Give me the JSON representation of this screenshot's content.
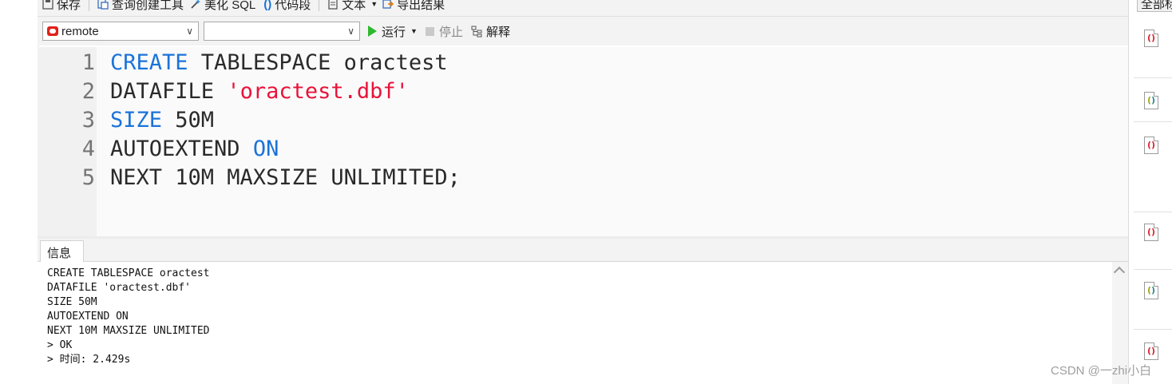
{
  "toolbar": {
    "save": "保存",
    "query_builder": "查询创建工具",
    "beautify_sql": "美化 SQL",
    "code_snippet": "代码段",
    "text": "文本",
    "export_results": "导出结果"
  },
  "run_bar": {
    "connection": "remote",
    "database": "",
    "run": "运行",
    "stop": "停止",
    "explain": "解释"
  },
  "editor": {
    "lines": [
      {
        "n": "1",
        "segments": [
          {
            "t": "CREATE",
            "c": "kw"
          },
          {
            "t": " TABLESPACE oractest",
            "c": "plain"
          }
        ]
      },
      {
        "n": "2",
        "segments": [
          {
            "t": "DATAFILE ",
            "c": "plain"
          },
          {
            "t": "'oractest.dbf'",
            "c": "str"
          }
        ]
      },
      {
        "n": "3",
        "segments": [
          {
            "t": "SIZE",
            "c": "kw"
          },
          {
            "t": " 50M",
            "c": "plain"
          }
        ]
      },
      {
        "n": "4",
        "segments": [
          {
            "t": "AUTOEXTEND ",
            "c": "plain"
          },
          {
            "t": "ON",
            "c": "kw"
          }
        ]
      },
      {
        "n": "5",
        "segments": [
          {
            "t": "NEXT 10M MAXSIZE UNLIMITED;",
            "c": "plain"
          }
        ]
      }
    ]
  },
  "info_panel": {
    "tab": "信息",
    "lines": [
      "CREATE TABLESPACE oractest",
      "DATAFILE 'oractest.dbf'",
      "SIZE 50M",
      "AUTOEXTEND ON",
      "NEXT 10M MAXSIZE UNLIMITED",
      "> OK",
      "> 时间: 2.429s"
    ]
  },
  "right_panel": {
    "all_button": "全部标",
    "icons": [
      "red-bracket-icon",
      "multicolor-bracket-icon",
      "red-bracket-icon",
      "red-bracket-icon",
      "multicolor-bracket-icon",
      "red-bracket-icon"
    ]
  },
  "watermark": "CSDN @一zhi小白",
  "colors": {
    "keyword": "#1a73d9",
    "string": "#e8133a",
    "run_green": "#2db82d",
    "oracle_red": "#e0211a"
  }
}
